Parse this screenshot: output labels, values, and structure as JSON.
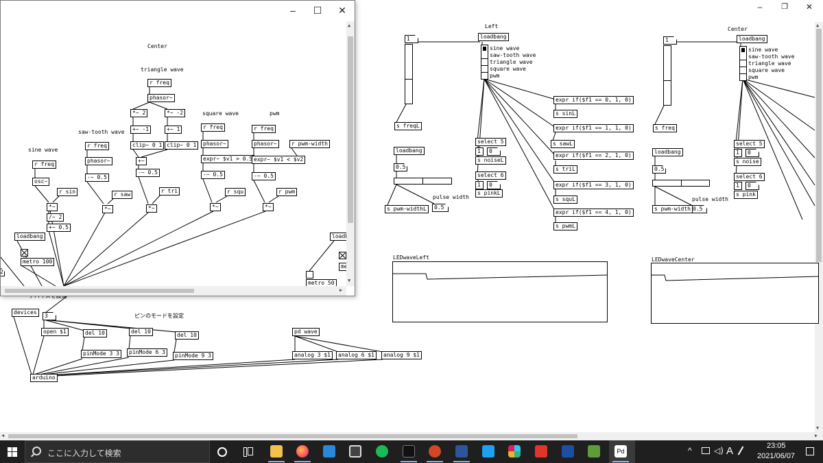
{
  "main_window": {
    "controls": [
      "–",
      "❐",
      "✕"
    ],
    "left_section": {
      "title": "Left",
      "number_box": "1",
      "loadbang": "loadbang",
      "radio_labels": [
        "sine wave",
        "saw-tooth wave",
        "triangle wave",
        "square wave",
        "pwm"
      ],
      "s_freq": "s freqL",
      "loadbang2": "loadbang",
      "msg_05": "0.5",
      "pulse_width_label": "pulse width",
      "pulse_width_value": "0.5",
      "s_pwm": "s pwm-widthL",
      "select5": "select 5",
      "one": "1",
      "zero": "0",
      "s_noise": "s noiseL",
      "select6": "select 6",
      "s_pink": "s pinkL",
      "exprs": [
        "expr if($f1 == 0, 1, 0)",
        "expr if($f1 == 1, 1, 0)",
        "expr if($f1 == 2, 1, 0)",
        "expr if($f1 == 3, 1, 0)",
        "expr if($f1 == 4, 1, 0)"
      ],
      "sends": [
        "s sinL",
        "s sawL",
        "s triL",
        "s squL",
        "s pwmL"
      ],
      "array_label": "LEDwaveLeft"
    },
    "center_section": {
      "title": "Center",
      "number_box": "1",
      "loadbang": "loadbang",
      "radio_labels": [
        "sine wave",
        "saw-tooth wave",
        "triangle wave",
        "square wave",
        "pwm"
      ],
      "s_freq": "s freq",
      "loadbang2": "loadbang",
      "msg_05": "0.5",
      "pulse_width_label": "pulse width",
      "pulse_width_value": "0.5",
      "s_pwm": "s pwm-width",
      "select5": "select 5",
      "one": "1",
      "zero": "0",
      "s_noise": "s noise",
      "select6": "select 6",
      "s_pink": "s pink",
      "array_label": "LEDwaveCenter"
    },
    "arduino_section": {
      "comment_device": "デバイスを設定",
      "comment_pin": "ピンのモードを設定",
      "devices": "devices",
      "number": "3",
      "open": "open $1",
      "del1": "del 10",
      "del2": "del 10",
      "del3": "del 10",
      "pin3": "pinMode 3 3",
      "pin6": "pinMode 6 3",
      "pin9": "pinMode 9 3",
      "pdwave": "pd wave",
      "analog3": "analog 3 $1",
      "analog6": "analog 6 $1",
      "analog9": "analog 9 $1",
      "arduino": "arduino"
    }
  },
  "sub_window": {
    "controls": [
      "–",
      "☐",
      "✕"
    ],
    "title_center": "Center",
    "triangle": {
      "label": "triangle wave",
      "r_freq": "r freq",
      "phasor": "phasor~",
      "mul2": "*~ 2",
      "mulm2": "*~ -2",
      "addm1": "+~ -1",
      "add1": "+~ 1",
      "clip1": "clip~ 0 1",
      "clip2": "clip~ 0 1",
      "sum": "+~",
      "minus": "-~ 0.5",
      "mul": "*~",
      "r_tri": "r tri"
    },
    "saw": {
      "label": "saw-tooth wave",
      "r_freq": "r freq",
      "phasor": "phasor~",
      "minus": "-~ 0.5",
      "mul": "*~",
      "r_saw": "r saw"
    },
    "sine": {
      "label": "sine wave",
      "r_freq": "r freq",
      "osc": "osc~",
      "r_sin": "r sin",
      "mul": "*~",
      "div": "/~ 2",
      "add": "+~ 0.5"
    },
    "square": {
      "label": "square wave",
      "r_freq": "r freq",
      "phasor": "phasor~",
      "expr": "expr~ $v1 > 0.5",
      "minus": "-~ 0.5",
      "mul": "*~",
      "r_squ": "r squ"
    },
    "pwm": {
      "label": "pwm",
      "r_freq": "r freq",
      "phasor": "phasor~",
      "r_width": "r pwm-width",
      "expr": "expr~ $v1 < $v2",
      "minus": "-~ 0.5",
      "mul": "*~",
      "r_pwm": "r pwm"
    },
    "loadbang": "loadbang",
    "metro": "metro 100",
    "loadbang2": "loadb",
    "metro2": "metro 50",
    "me": "me",
    "zero_box": "2"
  },
  "taskbar": {
    "search_placeholder": "ここに入力して検索",
    "ime": "A",
    "time": "23:05",
    "date": "2021/06/07",
    "pinned_icons": [
      "windows-start",
      "search",
      "cortana",
      "task-view",
      "file-explorer",
      "firefox",
      "mail",
      "store",
      "spotify",
      "thunderbolt-app",
      "powerpoint",
      "word",
      "twitter",
      "slack",
      "adobe-app",
      "video-editor",
      "minecraft",
      "pure-data"
    ],
    "accent": "#8ab4f8"
  },
  "colors": {
    "canvas_bg": "#ffffff",
    "taskbar_bg": "#1f1f1f",
    "scroll_thumb": "#c2c2c2"
  }
}
